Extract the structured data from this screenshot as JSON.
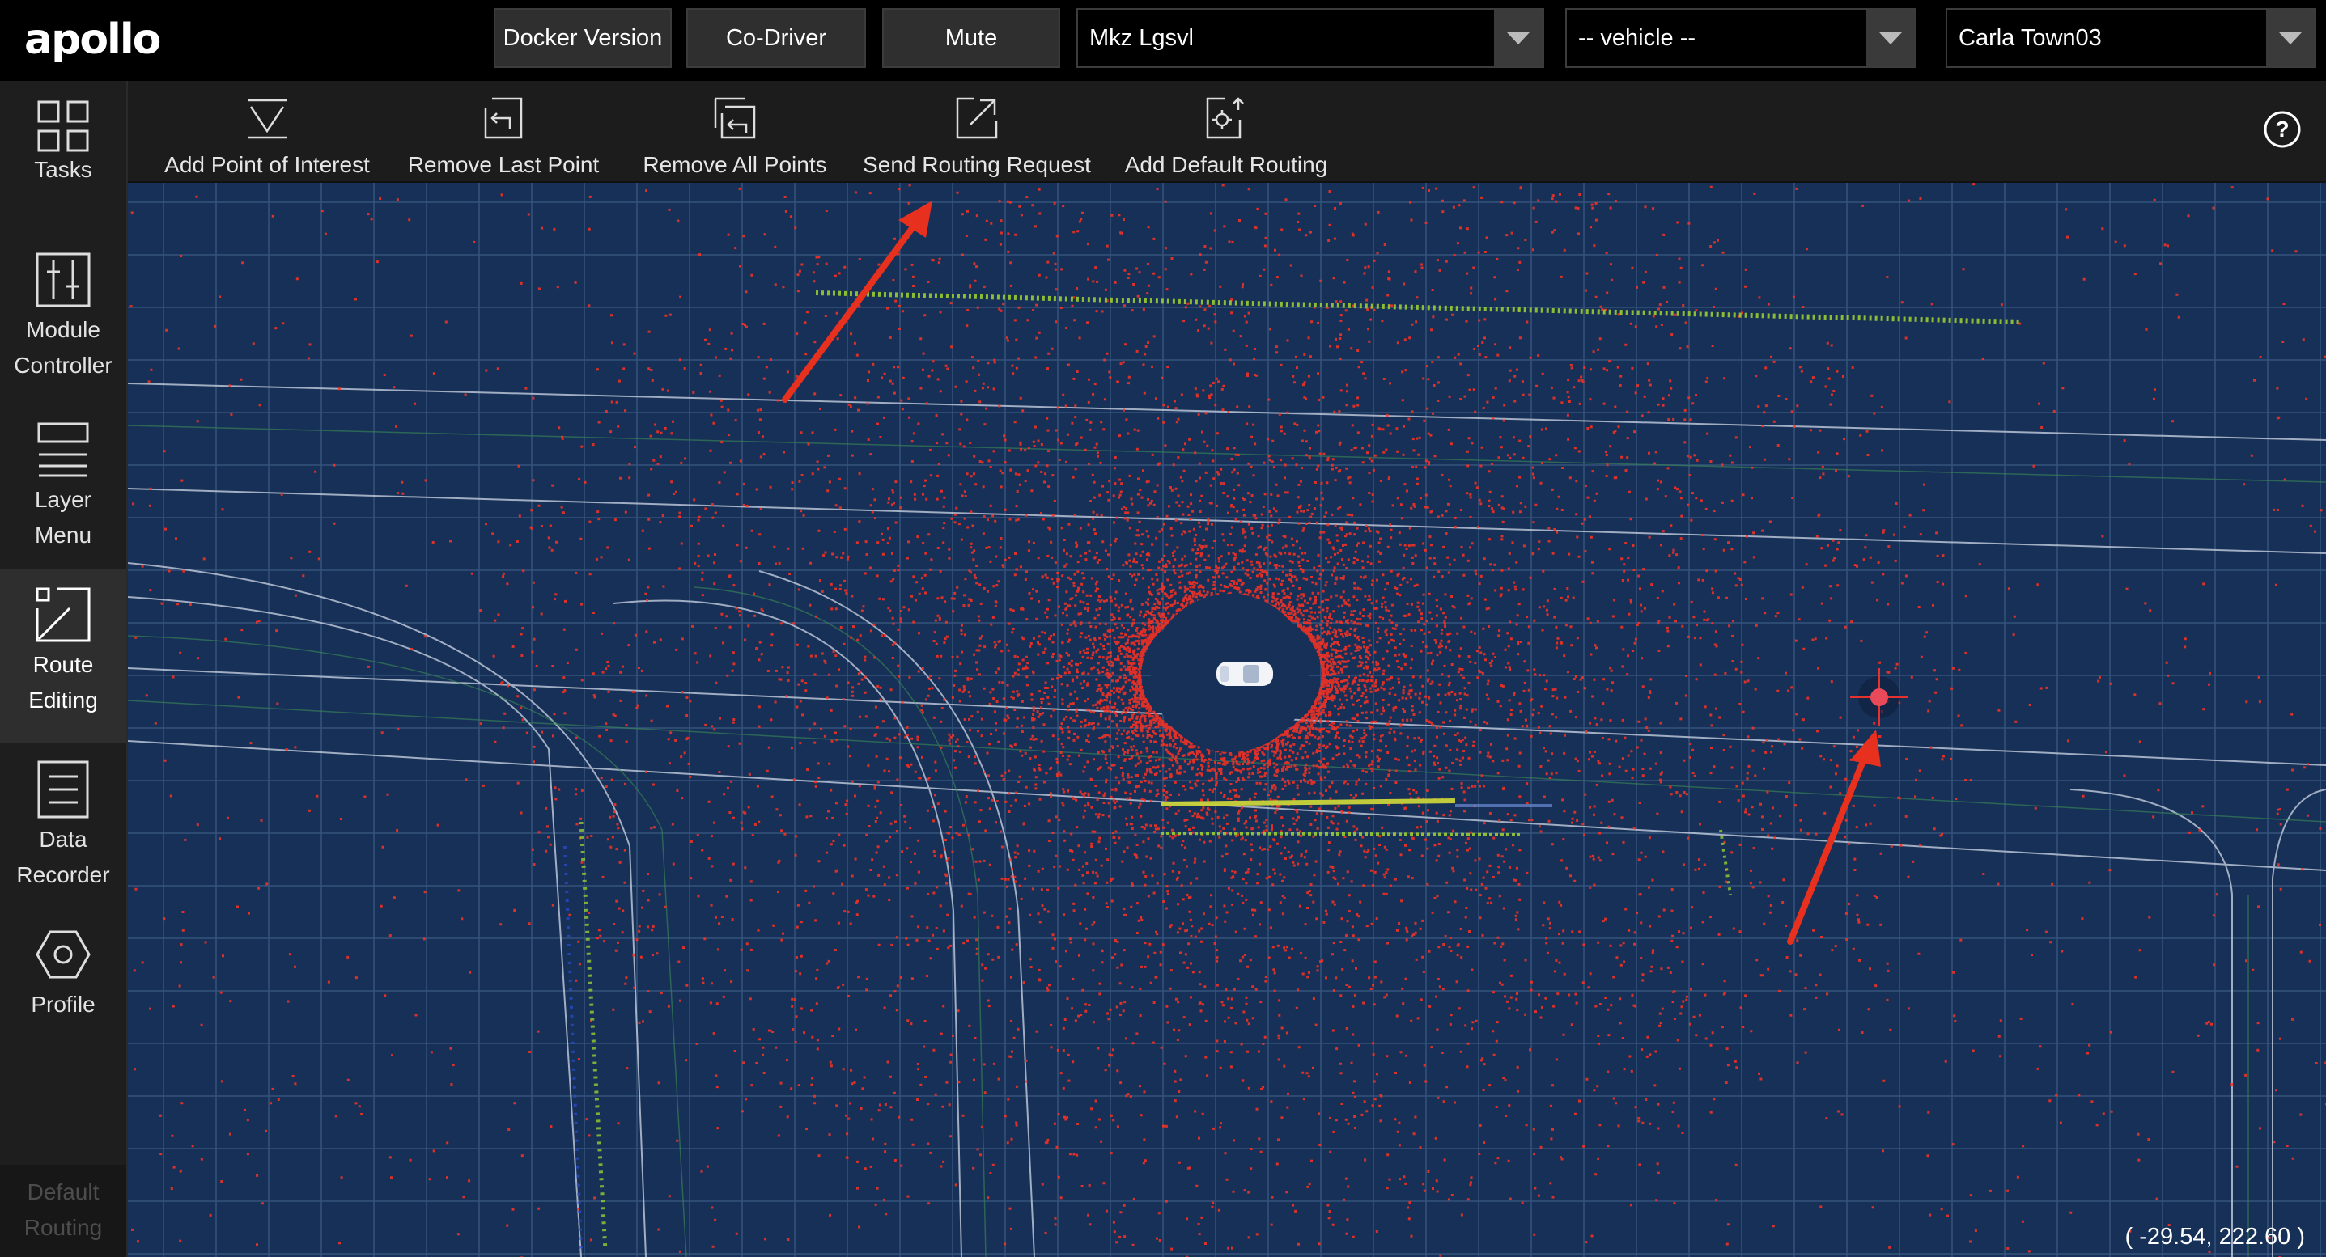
{
  "header": {
    "logo": "apollo",
    "buttons": [
      "Docker Version",
      "Co-Driver",
      "Mute"
    ],
    "selects": {
      "vehicle_model": "Mkz Lgsvl",
      "vehicle": "-- vehicle --",
      "map": "Carla Town03"
    }
  },
  "sidebar": {
    "items": [
      {
        "label1": "Tasks",
        "label2": "",
        "icon": "grid-icon"
      },
      {
        "label1": "Module",
        "label2": "Controller",
        "icon": "sliders-icon"
      },
      {
        "label1": "Layer",
        "label2": "Menu",
        "icon": "layers-icon"
      },
      {
        "label1": "Route",
        "label2": "Editing",
        "icon": "route-icon",
        "active": true
      },
      {
        "label1": "Data",
        "label2": "Recorder",
        "icon": "document-icon"
      },
      {
        "label1": "Profile",
        "label2": "",
        "icon": "hexagon-icon"
      }
    ],
    "default_routing": {
      "label1": "Default",
      "label2": "Routing"
    }
  },
  "toolbar": {
    "tools": [
      {
        "label": "Add Point of Interest",
        "icon": "funnel-icon"
      },
      {
        "label": "Remove Last Point",
        "icon": "undo-point-icon"
      },
      {
        "label": "Remove All Points",
        "icon": "clear-points-icon"
      },
      {
        "label": "Send Routing Request",
        "icon": "send-icon"
      },
      {
        "label": "Add Default Routing",
        "icon": "default-route-icon"
      }
    ],
    "help": "?"
  },
  "map": {
    "coordinates": "( -29.54, 222.60 )",
    "background_color": "#173057",
    "point_cloud_color": "#ff3020",
    "annotation_color": "#e8301f"
  }
}
